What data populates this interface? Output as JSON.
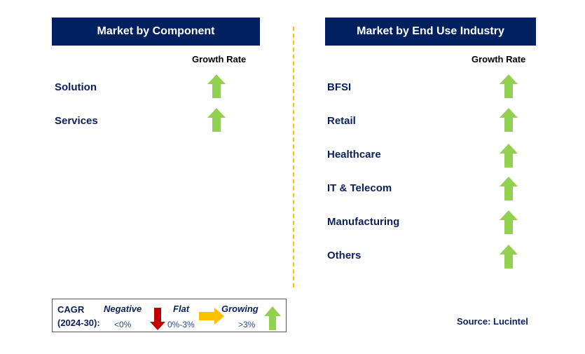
{
  "left_panel": {
    "title": "Market by Component",
    "growth_header": "Growth Rate",
    "items": [
      {
        "label": "Solution",
        "trend": "growing"
      },
      {
        "label": "Services",
        "trend": "growing"
      }
    ]
  },
  "right_panel": {
    "title": "Market by End Use Industry",
    "growth_header": "Growth Rate",
    "items": [
      {
        "label": "BFSI",
        "trend": "growing"
      },
      {
        "label": "Retail",
        "trend": "growing"
      },
      {
        "label": "Healthcare",
        "trend": "growing"
      },
      {
        "label": "IT & Telecom",
        "trend": "growing"
      },
      {
        "label": "Manufacturing",
        "trend": "growing"
      },
      {
        "label": "Others",
        "trend": "growing"
      }
    ]
  },
  "legend": {
    "cagr_label": "CAGR",
    "period_label": "(2024-30):",
    "negative": {
      "label": "Negative",
      "range": "<0%",
      "icon": "down-arrow-icon"
    },
    "flat": {
      "label": "Flat",
      "range": "0%-3%",
      "icon": "right-arrow-icon"
    },
    "growing": {
      "label": "Growing",
      "range": ">3%",
      "icon": "up-arrow-icon"
    }
  },
  "source": "Source: Lucintel",
  "colors": {
    "header_bg": "#002060",
    "growing": "#92d050",
    "flat": "#ffc000",
    "negative": "#c00000",
    "divider": "#ffc000"
  }
}
